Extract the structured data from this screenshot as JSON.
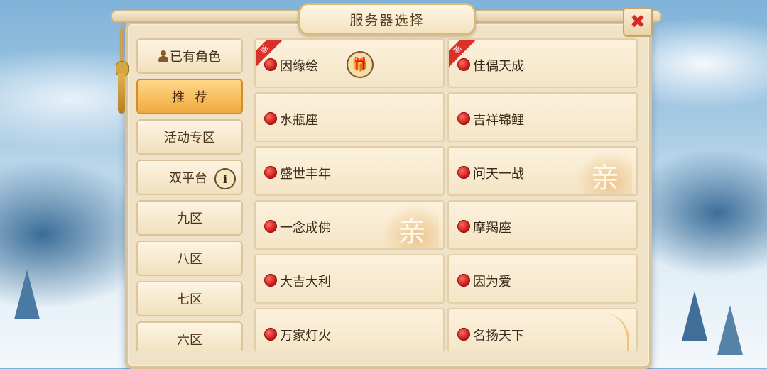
{
  "dialog": {
    "title": "服务器选择",
    "close_label": "✖"
  },
  "sidebar": {
    "items": [
      {
        "label": "已有角色",
        "icon": "person-icon",
        "active": false
      },
      {
        "label": "推荐",
        "active": true
      },
      {
        "label": "活动专区",
        "active": false
      },
      {
        "label": "双平台",
        "icon": "info-icon",
        "icon_glyph": "i",
        "active": false
      },
      {
        "label": "九区",
        "active": false
      },
      {
        "label": "八区",
        "active": false
      },
      {
        "label": "七区",
        "active": false
      },
      {
        "label": "六区",
        "active": false
      }
    ]
  },
  "servers": [
    {
      "name": "因缘绘",
      "new_tag": "新",
      "extra_icon": "gift-icon"
    },
    {
      "name": "佳偶天成",
      "new_tag": "新"
    },
    {
      "name": "水瓶座"
    },
    {
      "name": "吉祥锦鲤"
    },
    {
      "name": "盛世丰年"
    },
    {
      "name": "问天一战",
      "watermark": "recommend-badge-icon"
    },
    {
      "name": "一念成佛",
      "watermark": "recommend-badge-icon"
    },
    {
      "name": "摩羯座"
    },
    {
      "name": "大吉大利"
    },
    {
      "name": "因为爱"
    },
    {
      "name": "万家灯火"
    },
    {
      "name": "名扬天下",
      "watermark": "feather-icon"
    }
  ],
  "colors": {
    "status_dot": "#c41414",
    "active_tab": "#f0a93d",
    "close_x": "#d52a2a",
    "new_ribbon": "#d9302a"
  }
}
